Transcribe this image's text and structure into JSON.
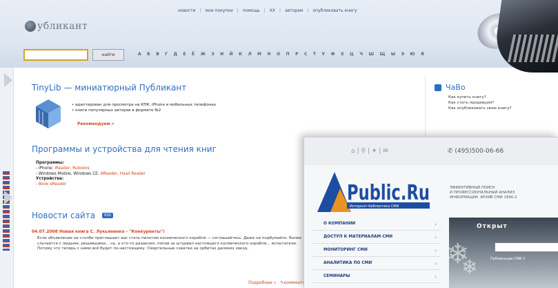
{
  "publikant": {
    "logo_text": "убликант",
    "nav": [
      "новости",
      "мои покупки",
      "помощь",
      "ХХ",
      "авторам",
      "опубликовать книгу"
    ],
    "search": {
      "placeholder": "",
      "button": "найти"
    },
    "alphabet": "А Б В Г Д Е Ё Ж З И Й К Л М Н О П Р С Т У Ф Х Ц Ч Ш Щ Ы Э Ю Я",
    "tinylib": {
      "title": "TinyLib — миниатюрный Публикант",
      "bullets": [
        "адаптирован для просмотра на КПК, iPhone и мобильных телефонах",
        "книги популярных авторов в формате fb2"
      ],
      "more": "Рекомендуем »"
    },
    "programs": {
      "title": "Программы и устройства для чтения книг",
      "heading1": "Программы:",
      "row1_prefix": "- iPhone:",
      "row1_links": "iReader, Rubooks",
      "row2_prefix": "- Windows Mobile, Windows CE:",
      "row2_links": "AReader, Haali Reader",
      "heading2": "Устройства:",
      "row3_prefix": "-",
      "row3_link": "Book eReader"
    },
    "news": {
      "title": "Новости сайта",
      "rss": "RSS",
      "date_line": "04.07.2008  Новая книга С. Лукьяненко - \"Конкуренты\"!",
      "body": "Если объявление на столбе приглашает вас стать пилотом космического корабля — соглашайтесь. Даже не подбумайте. Более случается с людьми, решившими... ну, а кто-то разделил, попав за штурвал настоящего космического корабля... испытатели. Потому что теперь с ними всё будет по-настоящему. Смертельные схватки на орбитах далеких звезд.",
      "link": "Подробнее »",
      "comments": "комментарии"
    },
    "faq": {
      "title": "ЧаВо",
      "items": [
        "Как купить книгу?",
        "Как стать продавцом?",
        "Как опубликовать свою книгу?"
      ]
    }
  },
  "publicru": {
    "toolbar_icons": "⌂  |  ⚲  |  ✦  |  ✉",
    "phone": "✆ (495)500-06-66",
    "logo_text": "Public.Ru",
    "logo_sub": "Интернет-библиотека СМИ",
    "tagline": [
      "ЭФФЕКТИВНЫЙ ПОИСК",
      "И ПРОФЕССИОНАЛЬНЫЙ АНАЛИЗ",
      "ИНФОРМАЦИИ. АРХИВ СМИ 1990-2"
    ],
    "menu": [
      "О КОМПАНИИ",
      "ДОСТУП К МАТЕРИАЛАМ СМИ",
      "МОНИТОРИНГ СМИ",
      "АНАЛИТИКА ПО СМИ",
      "СЕМИНАРЫ"
    ],
    "winter_label": "Открыт",
    "winter_sub": "Публикации СМИ 2"
  },
  "colors": {
    "accent_blue": "#2d6fc0",
    "accent_orange": "#d1461f",
    "nav_blue": "#1d3e7a"
  }
}
